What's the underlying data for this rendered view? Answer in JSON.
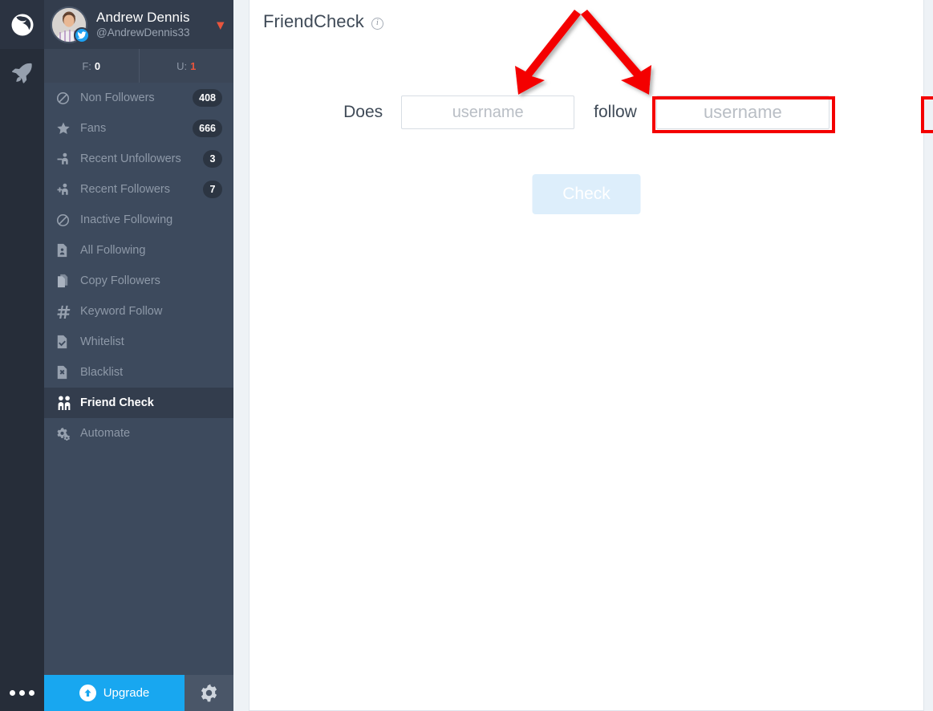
{
  "app": {
    "rail": {
      "logo_icon": "bird-logo-icon",
      "rocket_icon": "rocket-icon",
      "dots_icon": "more-dots-icon"
    }
  },
  "sidebar": {
    "profile": {
      "name": "Andrew Dennis",
      "handle": "@AndrewDennis33",
      "avatar_icon": "user-avatar",
      "network_badge_icon": "twitter-bird-icon",
      "dropdown_icon": "chevron-down-icon"
    },
    "stats": [
      {
        "label": "F:",
        "value": "0",
        "highlight": false
      },
      {
        "label": "U:",
        "value": "1",
        "highlight": true
      }
    ],
    "items": [
      {
        "label": "Non Followers",
        "badge": "408",
        "icon": "ban-circle-icon",
        "active": false
      },
      {
        "label": "Fans",
        "badge": "666",
        "icon": "star-icon",
        "active": false
      },
      {
        "label": "Recent Unfollowers",
        "badge": "3",
        "icon": "user-minus-icon",
        "active": false
      },
      {
        "label": "Recent Followers",
        "badge": "7",
        "icon": "user-plus-icon",
        "active": false
      },
      {
        "label": "Inactive Following",
        "badge": "",
        "icon": "ban-circle-icon",
        "active": false
      },
      {
        "label": "All Following",
        "badge": "",
        "icon": "document-user-icon",
        "active": false
      },
      {
        "label": "Copy Followers",
        "badge": "",
        "icon": "copy-documents-icon",
        "active": false
      },
      {
        "label": "Keyword Follow",
        "badge": "",
        "icon": "hashtag-icon",
        "active": false
      },
      {
        "label": "Whitelist",
        "badge": "",
        "icon": "document-check-icon",
        "active": false
      },
      {
        "label": "Blacklist",
        "badge": "",
        "icon": "document-x-icon",
        "active": false
      },
      {
        "label": "Friend Check",
        "badge": "",
        "icon": "two-people-icon",
        "active": true
      },
      {
        "label": "Automate",
        "badge": "",
        "icon": "gears-icon",
        "active": false
      }
    ],
    "bottom": {
      "upgrade_label": "Upgrade",
      "upgrade_icon": "arrow-up-circle-icon",
      "settings_icon": "gear-icon"
    }
  },
  "main": {
    "title": "FriendCheck",
    "info_icon": "info-circle-icon",
    "info_glyph": "i",
    "form": {
      "label_does": "Does",
      "label_follow": "follow",
      "input_a_value": "",
      "input_a_placeholder": "username",
      "input_b_value": "",
      "input_b_placeholder": "username"
    },
    "check_button_label": "Check"
  },
  "annotations": {
    "highlight_color": "#f40000",
    "arrow_color": "#f40000",
    "boxes": [
      {
        "name": "left-username-highlight"
      },
      {
        "name": "right-username-highlight"
      }
    ],
    "arrows": [
      {
        "name": "arrow-to-left-input"
      },
      {
        "name": "arrow-to-right-input"
      }
    ]
  },
  "colors": {
    "brand_blue": "#18a7f0",
    "sidebar_bg": "#3d4a5d",
    "sidebar_dark": "#333d4d",
    "rail_bg": "#262d39",
    "accent_red": "#e8553d",
    "page_bg": "#eef2f6"
  }
}
